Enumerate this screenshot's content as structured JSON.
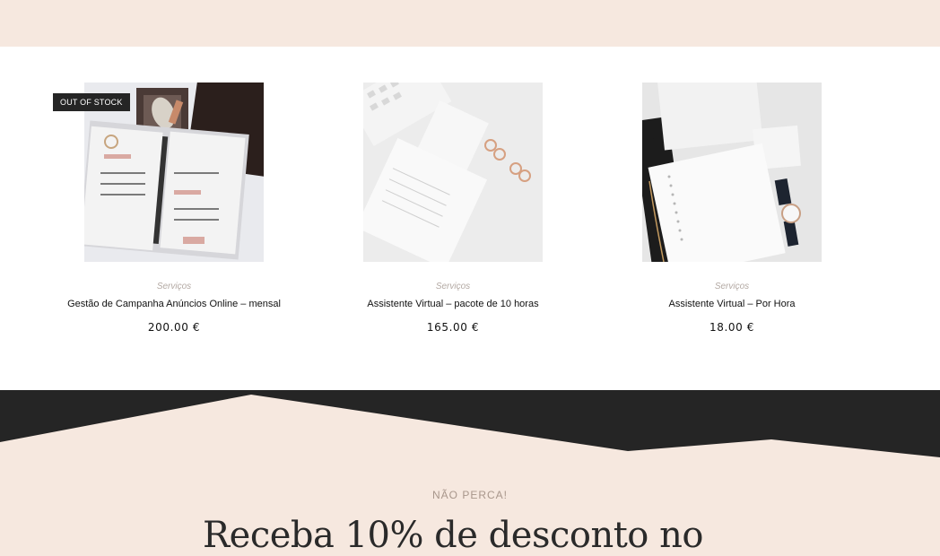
{
  "products": [
    {
      "category": "Serviços",
      "title": "Gestão de Campanha Anúncios Online – mensal",
      "price": "200.00 €",
      "badge": "OUT OF STOCK"
    },
    {
      "category": "Serviços",
      "title": "Assistente Virtual – pacote de 10 horas",
      "price": "165.00 €"
    },
    {
      "category": "Serviços",
      "title": "Assistente Virtual – Por Hora",
      "price": "18.00 €"
    }
  ],
  "promo": {
    "eyebrow": "NÃO PERCA!",
    "headline": "Receba 10% de desconto no"
  },
  "colors": {
    "band": "#f6e8df",
    "dark": "#252525",
    "badge": "#252525"
  }
}
